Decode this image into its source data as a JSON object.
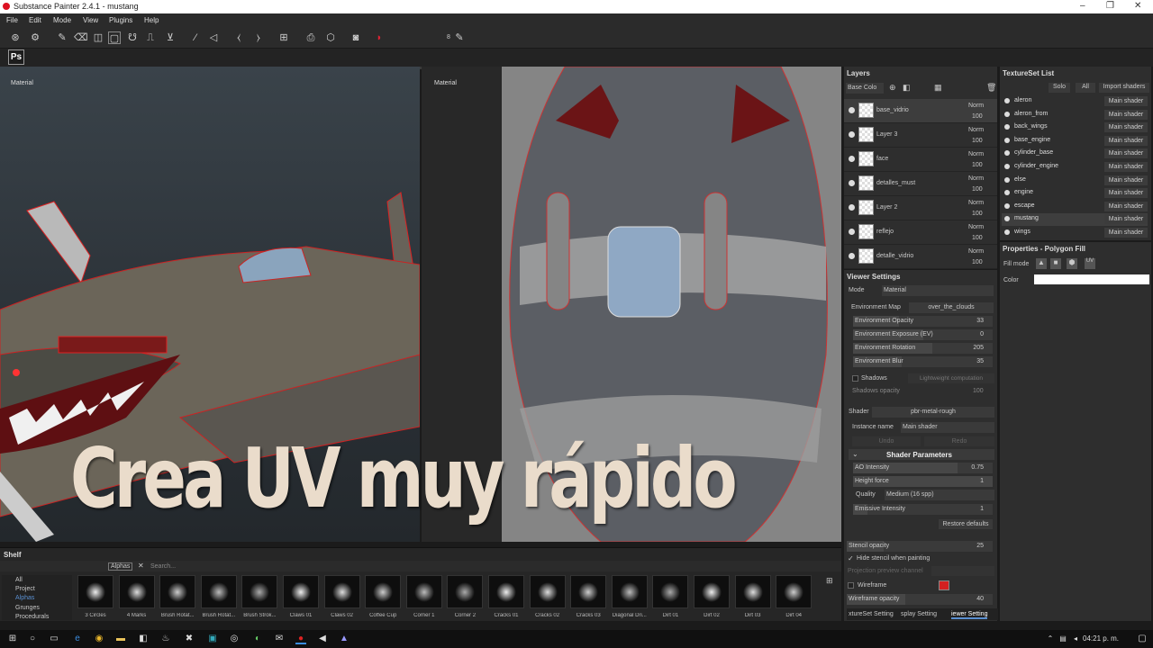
{
  "app": {
    "title": "Substance Painter 2.4.1 - mustang"
  },
  "menu": [
    "File",
    "Edit",
    "Mode",
    "View",
    "Plugins",
    "Help"
  ],
  "toolbar": {
    "brush_size": "8"
  },
  "sidebar": {
    "ps_label": "Ps"
  },
  "viewports": {
    "left_label": "Material",
    "right_label": "Material"
  },
  "overlay": {
    "title": "Crea UV muy rápido"
  },
  "layers": {
    "title": "Layers",
    "channel": "Base Colo",
    "items": [
      {
        "name": "base_vidrio",
        "blend": "Norm",
        "opacity": "100"
      },
      {
        "name": "Layer 3",
        "blend": "Norm",
        "opacity": "100"
      },
      {
        "name": "face",
        "blend": "Norm",
        "opacity": "100"
      },
      {
        "name": "detalles_must",
        "blend": "Norm",
        "opacity": "100"
      },
      {
        "name": "Layer 2",
        "blend": "Norm",
        "opacity": "100"
      },
      {
        "name": "reflejo",
        "blend": "Norm",
        "opacity": "100"
      },
      {
        "name": "detalle_vidrio",
        "blend": "Norm",
        "opacity": "100"
      }
    ]
  },
  "viewer": {
    "title": "Viewer Settings",
    "mode_label": "Mode",
    "mode_value": "Material",
    "env_map_label": "Environment Map",
    "env_map_value": "over_the_clouds",
    "sliders": [
      {
        "label": "Environment Opacity",
        "value": "33",
        "fill": 0.33
      },
      {
        "label": "Environment Exposure (EV)",
        "value": "0",
        "fill": 0.5
      },
      {
        "label": "Environment Rotation",
        "value": "205",
        "fill": 0.57
      },
      {
        "label": "Environment Blur",
        "value": "35",
        "fill": 0.35
      }
    ],
    "shadows_label": "Shadows",
    "shadows_value": "Lightweight computation",
    "shadows_opacity_label": "Shadows opacity",
    "shadows_opacity_value": "100",
    "shader_label": "Shader",
    "shader_value": "pbr-metal-rough",
    "instance_label": "Instance name",
    "instance_value": "Main shader",
    "undo": "Undo",
    "redo": "Redo",
    "shader_params_title": "Shader Parameters",
    "ao_label": "AO Intensity",
    "ao_value": "0.75",
    "ao_fill": 0.75,
    "height_label": "Height force",
    "height_value": "1",
    "height_fill": 1,
    "quality_label": "Quality",
    "quality_value": "Medium (16 spp)",
    "emissive_label": "Emissive Intensity",
    "emissive_value": "1",
    "emissive_fill": 0.1,
    "restore": "Restore defaults",
    "stencil_label": "Stencil opacity",
    "stencil_value": "25",
    "stencil_fill": 0.25,
    "hide_stencil": "Hide stencil when painting",
    "projection": "Projection preview channel",
    "wireframe_label": "Wireframe",
    "wireframe_color": "#d42020",
    "wire_opacity_label": "Wireframe opacity",
    "wire_opacity_value": "40",
    "wire_opacity_fill": 0.4,
    "tabs": [
      "xtureSet Setting",
      "splay Setting",
      "iewer Setting"
    ]
  },
  "textureset": {
    "title": "TextureSet List",
    "solo": "Solo",
    "all": "All",
    "import": "Import shaders",
    "items": [
      {
        "name": "aleron",
        "shader": "Main shader"
      },
      {
        "name": "aleron_from",
        "shader": "Main shader"
      },
      {
        "name": "back_wings",
        "shader": "Main shader"
      },
      {
        "name": "base_engine",
        "shader": "Main shader"
      },
      {
        "name": "cylinder_base",
        "shader": "Main shader"
      },
      {
        "name": "cylinder_engine",
        "shader": "Main shader"
      },
      {
        "name": "else",
        "shader": "Main shader"
      },
      {
        "name": "engine",
        "shader": "Main shader"
      },
      {
        "name": "escape",
        "shader": "Main shader"
      },
      {
        "name": "mustang",
        "shader": "Main shader"
      },
      {
        "name": "wings",
        "shader": "Main shader"
      }
    ]
  },
  "properties": {
    "title": "Properties - Polygon Fill",
    "fill_mode": "Fill mode",
    "color_label": "Color",
    "color_value": "#ffffff"
  },
  "shelf": {
    "title": "Shelf",
    "filter": "Alphas",
    "search_placeholder": "Search...",
    "categories": [
      "All",
      "Project",
      "Alphas",
      "Grunges",
      "Procedurals"
    ],
    "brushes": [
      "3 Circles",
      "4 Marks",
      "Brush Rotat...",
      "Brush Rotat...",
      "Brush Strok...",
      "Claws 01",
      "Claws 02",
      "Coffee Cup",
      "Corner 1",
      "Corner 2",
      "Cracks 01",
      "Cracks 02",
      "Cracks 03",
      "Diagonal Dri...",
      "Dirt 01",
      "Dirt 02",
      "Dirt 03",
      "Dirt 04"
    ]
  },
  "taskbar": {
    "time": "04:21 p. m."
  },
  "colors": {
    "accent": "#5a8fd0",
    "wire": "#d42020",
    "panel": "#2e2e2e"
  }
}
